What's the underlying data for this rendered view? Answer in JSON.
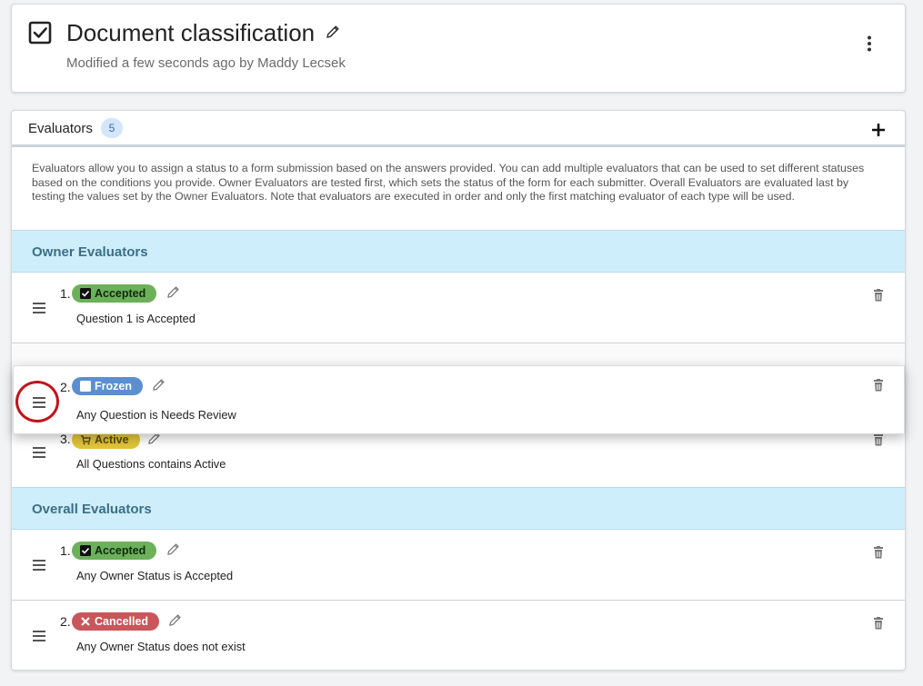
{
  "header": {
    "title": "Document classification",
    "modified": "Modified a few seconds ago by Maddy Lecsek"
  },
  "evaluators": {
    "title": "Evaluators",
    "count": "5",
    "description": "Evaluators allow you to assign a status to a form submission based on the answers provided. You can add multiple evaluators that can be used to set different statuses based on the conditions you provide. Owner Evaluators are tested first, which sets the status of the form for each submitter. Overall Evaluators are evaluated last by testing the values set by the Owner Evaluators. Note that evaluators are executed in order and only the first matching evaluator of each type will be used.",
    "owner_section": "Owner Evaluators",
    "overall_section": "Overall Evaluators",
    "owner_items": [
      {
        "num": "1.",
        "status": "Accepted",
        "condition": "Question 1 is Accepted",
        "icon": "checkbox-checked-icon",
        "color": "#6bb15a"
      },
      {
        "num": "2.",
        "status": "Frozen",
        "condition": "Any Question is Needs Review",
        "icon": "checkbox-empty-icon",
        "color": "#5b8fd0"
      },
      {
        "num": "3.",
        "status": "Active",
        "condition": "All Questions contains Active",
        "icon": "cart-icon",
        "color": "#e2c53a"
      }
    ],
    "overall_items": [
      {
        "num": "1.",
        "status": "Accepted",
        "condition": "Any Owner Status is Accepted",
        "icon": "checkbox-checked-icon",
        "color": "#6bb15a"
      },
      {
        "num": "2.",
        "status": "Cancelled",
        "condition": "Any Owner Status does not exist",
        "icon": "x-icon",
        "color": "#c9565a"
      }
    ]
  }
}
